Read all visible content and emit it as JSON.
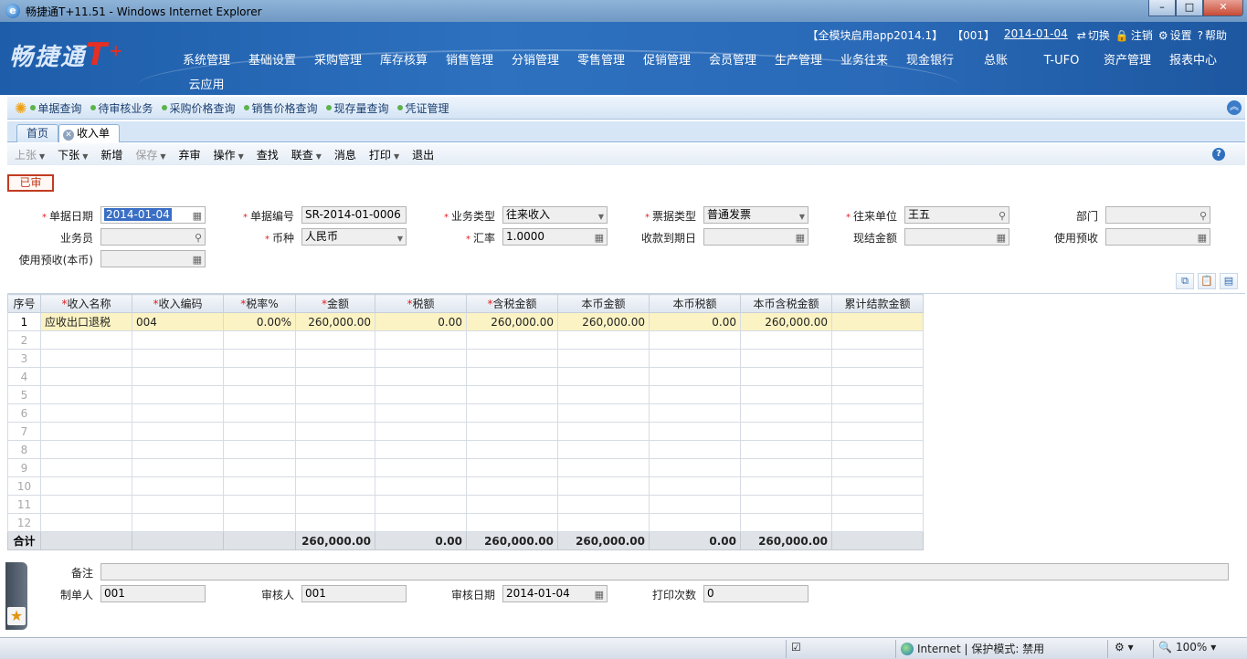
{
  "window": {
    "title": "畅捷通T+11.51 - Windows Internet Explorer",
    "controls": [
      "–",
      "□",
      "✕"
    ]
  },
  "banner": {
    "logo_text": "畅捷通",
    "logo_t": "T",
    "logo_plus": "+",
    "account": "【全模块启用app2014.1】",
    "org": "【001】",
    "date": "2014-01-04",
    "links": [
      {
        "icon": "switch-icon",
        "glyph": "⇄",
        "label": "切换"
      },
      {
        "icon": "lock-icon",
        "glyph": "🔒",
        "label": "注销"
      },
      {
        "icon": "settings-icon",
        "glyph": "⚙",
        "label": "设置"
      },
      {
        "icon": "help-icon",
        "glyph": "?",
        "label": "帮助"
      }
    ]
  },
  "menu": {
    "row1": [
      "系统管理",
      "基础设置",
      "采购管理",
      "库存核算",
      "销售管理",
      "分销管理",
      "零售管理",
      "促销管理",
      "会员管理",
      "生产管理",
      "业务往来",
      "现金银行",
      "总账",
      "T-UFO",
      "资产管理",
      "报表中心"
    ],
    "row2": [
      "云应用"
    ]
  },
  "quickbar": {
    "items": [
      "单据查询",
      "待审核业务",
      "采购价格查询",
      "销售价格查询",
      "现存量查询",
      "凭证管理"
    ]
  },
  "tabs": {
    "home": "首页",
    "current": "收入单"
  },
  "toolbar": {
    "items": [
      {
        "label": "上张",
        "caret": true,
        "disabled": true
      },
      {
        "label": "下张",
        "caret": true,
        "disabled": false
      },
      {
        "label": "新增",
        "caret": false,
        "disabled": false
      },
      {
        "label": "保存",
        "caret": true,
        "disabled": true
      },
      {
        "label": "弃审",
        "caret": false,
        "disabled": false
      },
      {
        "label": "操作",
        "caret": true,
        "disabled": false
      },
      {
        "label": "查找",
        "caret": false,
        "disabled": false
      },
      {
        "label": "联查",
        "caret": true,
        "disabled": false
      },
      {
        "label": "消息",
        "caret": false,
        "disabled": false
      },
      {
        "label": "打印",
        "caret": true,
        "disabled": false
      },
      {
        "label": "退出",
        "caret": false,
        "disabled": false
      }
    ]
  },
  "form": {
    "status_stamp": "已审",
    "doc_date": {
      "label": "单据日期",
      "value": "2014-01-04"
    },
    "doc_no": {
      "label": "单据编号",
      "value": "SR-2014-01-0006"
    },
    "biz_type": {
      "label": "业务类型",
      "value": "往来收入"
    },
    "invoice_type": {
      "label": "票据类型",
      "value": "普通发票"
    },
    "partner": {
      "label": "往来单位",
      "value": "王五"
    },
    "department": {
      "label": "部门",
      "value": ""
    },
    "salesman": {
      "label": "业务员",
      "value": ""
    },
    "currency": {
      "label": "币种",
      "value": "人民币"
    },
    "exchange_rate": {
      "label": "汇率",
      "value": "1.0000"
    },
    "due_date": {
      "label": "收款到期日",
      "value": ""
    },
    "cash_amount": {
      "label": "现结金额",
      "value": ""
    },
    "use_advance": {
      "label": "使用预收",
      "value": ""
    },
    "use_advance_local": {
      "label": "使用预收(本币)",
      "value": ""
    }
  },
  "grid": {
    "columns": [
      {
        "label": "序号",
        "required": false
      },
      {
        "label": "收入名称",
        "required": true
      },
      {
        "label": "收入编码",
        "required": true
      },
      {
        "label": "税率%",
        "required": true
      },
      {
        "label": "金额",
        "required": true
      },
      {
        "label": "税额",
        "required": true
      },
      {
        "label": "含税金额",
        "required": true
      },
      {
        "label": "本币金额",
        "required": false
      },
      {
        "label": "本币税额",
        "required": false
      },
      {
        "label": "本币含税金额",
        "required": false
      },
      {
        "label": "累计结款金额",
        "required": false
      }
    ],
    "rows": [
      [
        "1",
        "应收出口退税",
        "004",
        "0.00%",
        "260,000.00",
        "0.00",
        "260,000.00",
        "260,000.00",
        "0.00",
        "260,000.00",
        ""
      ],
      [
        "2",
        "",
        "",
        "",
        "",
        "",
        "",
        "",
        "",
        "",
        ""
      ],
      [
        "3",
        "",
        "",
        "",
        "",
        "",
        "",
        "",
        "",
        "",
        ""
      ],
      [
        "4",
        "",
        "",
        "",
        "",
        "",
        "",
        "",
        "",
        "",
        ""
      ],
      [
        "5",
        "",
        "",
        "",
        "",
        "",
        "",
        "",
        "",
        "",
        ""
      ],
      [
        "6",
        "",
        "",
        "",
        "",
        "",
        "",
        "",
        "",
        "",
        ""
      ],
      [
        "7",
        "",
        "",
        "",
        "",
        "",
        "",
        "",
        "",
        "",
        ""
      ],
      [
        "8",
        "",
        "",
        "",
        "",
        "",
        "",
        "",
        "",
        "",
        ""
      ],
      [
        "9",
        "",
        "",
        "",
        "",
        "",
        "",
        "",
        "",
        "",
        ""
      ],
      [
        "10",
        "",
        "",
        "",
        "",
        "",
        "",
        "",
        "",
        "",
        ""
      ],
      [
        "11",
        "",
        "",
        "",
        "",
        "",
        "",
        "",
        "",
        "",
        ""
      ],
      [
        "12",
        "",
        "",
        "",
        "",
        "",
        "",
        "",
        "",
        "",
        ""
      ]
    ],
    "total": [
      "合计",
      "",
      "",
      "",
      "260,000.00",
      "0.00",
      "260,000.00",
      "260,000.00",
      "0.00",
      "260,000.00",
      ""
    ],
    "tool_icons": [
      "copy-icon",
      "paste-icon",
      "excel-export-icon"
    ]
  },
  "footer": {
    "remark": {
      "label": "备注",
      "value": ""
    },
    "maker": {
      "label": "制单人",
      "value": "001"
    },
    "auditor": {
      "label": "审核人",
      "value": "001"
    },
    "audit_date": {
      "label": "审核日期",
      "value": "2014-01-04"
    },
    "print_count": {
      "label": "打印次数",
      "value": "0"
    }
  },
  "statusbar": {
    "zone": "Internet | 保护模式: 禁用",
    "zoom": "100%"
  }
}
